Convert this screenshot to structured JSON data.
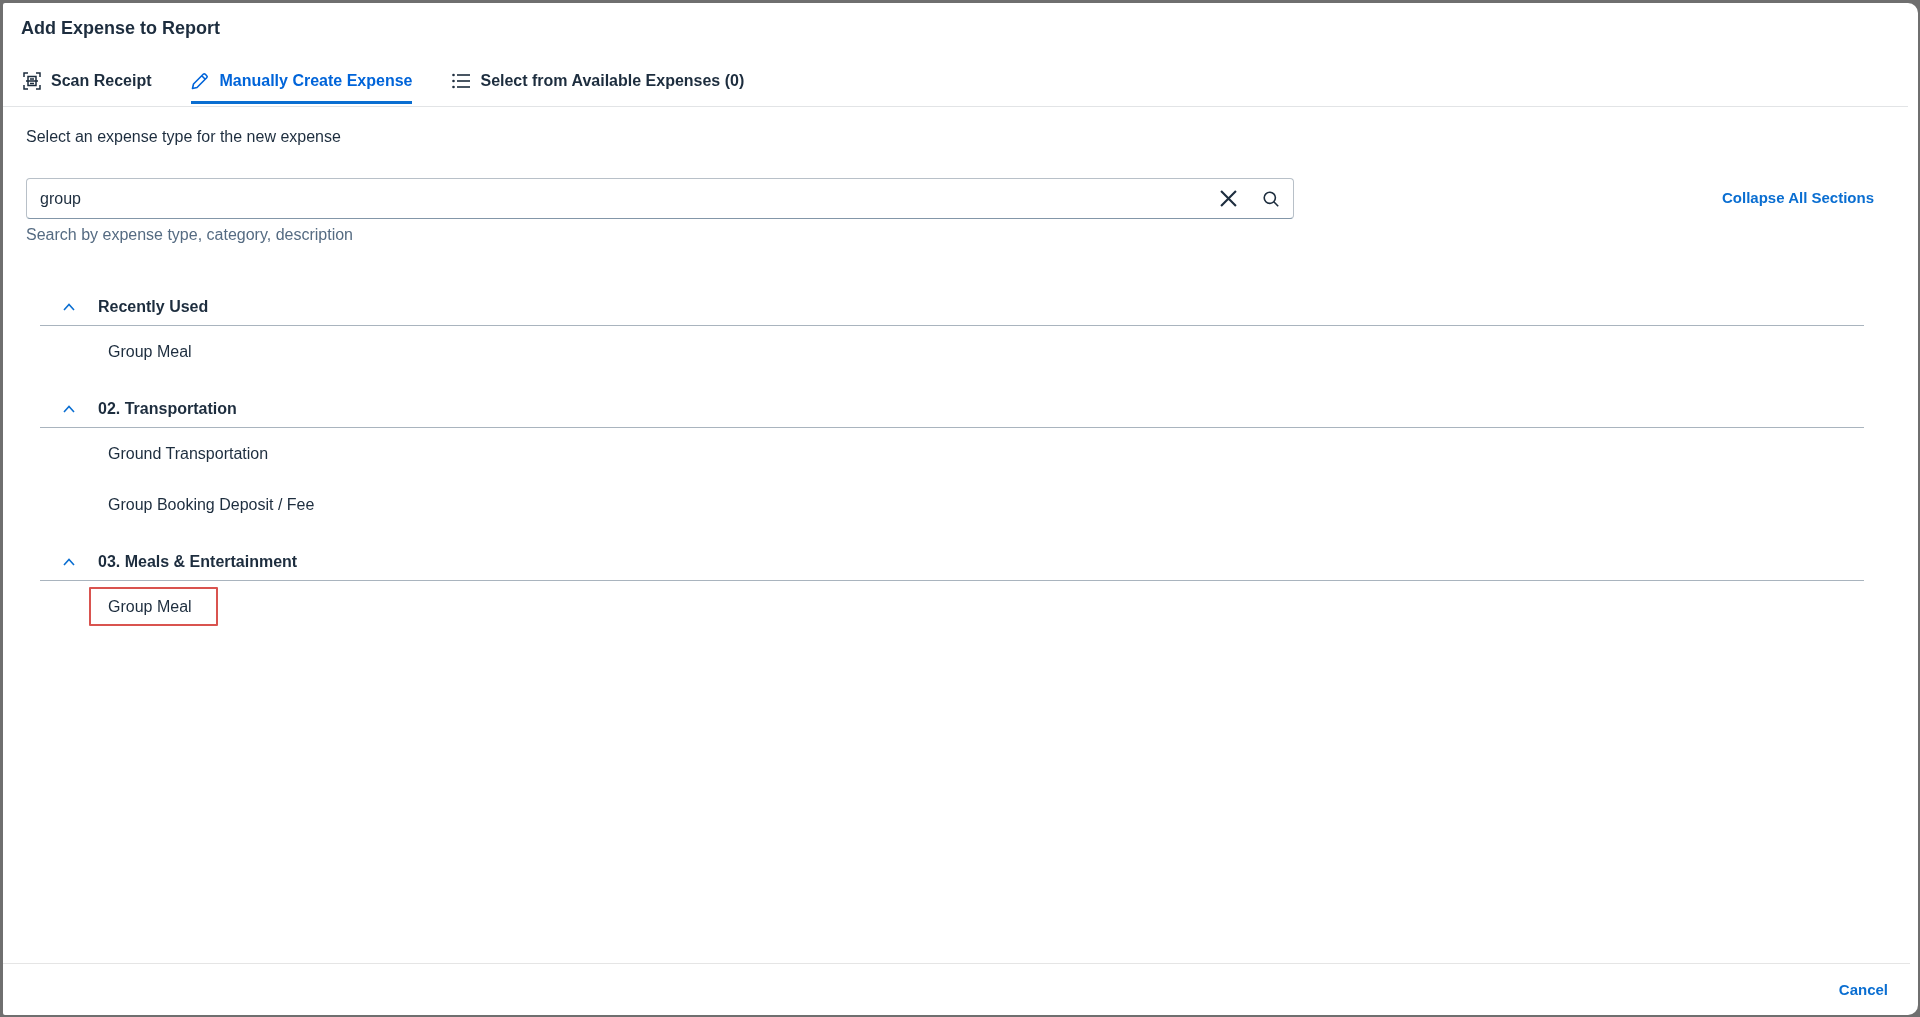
{
  "dialog": {
    "title": "Add Expense to Report"
  },
  "tabs": [
    {
      "kind": "scan",
      "label": "Scan Receipt",
      "selected": false
    },
    {
      "kind": "manual",
      "label": "Manually Create Expense",
      "selected": true
    },
    {
      "kind": "select",
      "label": "Select from Available Expenses (0)",
      "selected": false
    }
  ],
  "instruction": "Select an expense type for the new expense",
  "search": {
    "value": "group",
    "hint": "Search by expense type, category, description"
  },
  "collapse_all_link": "Collapse All Sections",
  "sections": [
    {
      "title": "Recently Used",
      "expanded": true,
      "items": [
        {
          "label": "Group Meal",
          "highlighted": false
        }
      ]
    },
    {
      "title": "02. Transportation",
      "expanded": true,
      "items": [
        {
          "label": "Ground Transportation",
          "highlighted": false
        },
        {
          "label": "Group Booking Deposit / Fee",
          "highlighted": false
        }
      ]
    },
    {
      "title": "03. Meals & Entertainment",
      "expanded": true,
      "items": [
        {
          "label": "Group Meal",
          "highlighted": true
        }
      ]
    }
  ],
  "footer": {
    "cancel_button": "Cancel"
  }
}
